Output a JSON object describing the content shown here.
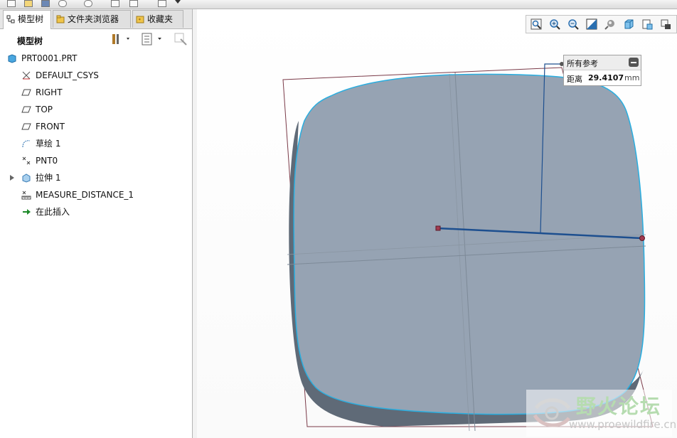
{
  "tabs": [
    {
      "label": "模型树",
      "icon": "model-tree-icon"
    },
    {
      "label": "文件夹浏览器",
      "icon": "folder-browser-icon"
    },
    {
      "label": "收藏夹",
      "icon": "favorites-icon"
    }
  ],
  "tree_toolbar": {
    "title": "模型树",
    "settings_icon": "tools-icon",
    "show_icon": "list-icon",
    "filter_icon": "filter-icon"
  },
  "tree": {
    "root": {
      "label": "PRT0001.PRT",
      "icon": "part-icon"
    },
    "items": [
      {
        "label": "DEFAULT_CSYS",
        "icon": "csys-icon"
      },
      {
        "label": "RIGHT",
        "icon": "datum-plane-icon"
      },
      {
        "label": "TOP",
        "icon": "datum-plane-icon"
      },
      {
        "label": "FRONT",
        "icon": "datum-plane-icon"
      },
      {
        "label": "草绘 1",
        "icon": "sketch-icon"
      },
      {
        "label": "PNT0",
        "icon": "datum-point-icon"
      },
      {
        "label": "拉伸 1",
        "icon": "extrude-icon"
      },
      {
        "label": "MEASURE_DISTANCE_1",
        "icon": "measure-icon"
      },
      {
        "label": "在此插入",
        "icon": "insert-arrow-icon"
      }
    ]
  },
  "view_toolbar": {
    "buttons": [
      "refit-icon",
      "zoom-in-icon",
      "zoom-out-icon",
      "repaint-icon",
      "display-style-icon",
      "saved-orientations-icon",
      "view-manager-icon",
      "datum-display-icon"
    ]
  },
  "measure_panel": {
    "title": "所有参考",
    "distance_label": "距离",
    "distance_value": "29.4107",
    "unit": "mm"
  },
  "watermark": {
    "title": "野火论坛",
    "url": "www.proewildfire.cn"
  },
  "colors": {
    "model_face": "#96a3b3",
    "model_edge": "#29aee0",
    "datum_frame": "#7a3a48",
    "measure_line": "#1d4f8f"
  }
}
